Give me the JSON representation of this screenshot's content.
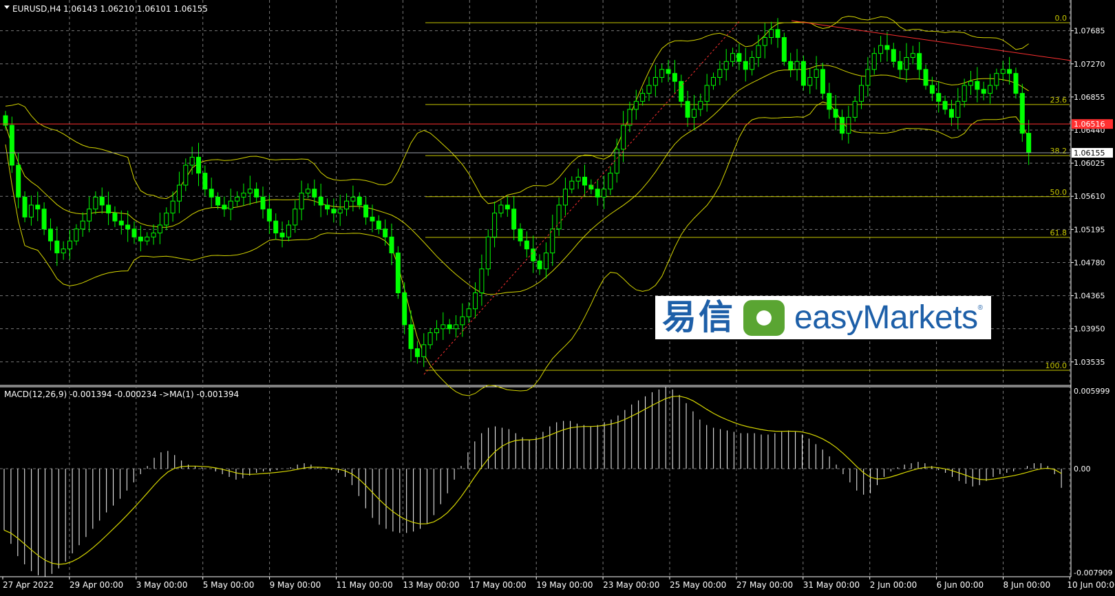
{
  "header": {
    "symbol": "EURUSD,H4",
    "ohlc": "1.06143 1.06210 1.06101 1.06155"
  },
  "macd_header": {
    "label": "MACD(12,26,9) -0.001394 -0.000234  ->MA(1) -0.001394"
  },
  "price_axis": {
    "ticks": [
      "1.07685",
      "1.07270",
      "1.06855",
      "1.06440",
      "1.06025",
      "1.05610",
      "1.05195",
      "1.04780",
      "1.04365",
      "1.03950",
      "1.03535"
    ],
    "red_level_label": "1.06516",
    "current_price_label": "1.06155"
  },
  "macd_axis": {
    "ticks": [
      "0.005999",
      "0.00",
      "-0.007909"
    ]
  },
  "time_axis": {
    "ticks": [
      "27 Apr 2022",
      "29 Apr 00:00",
      "3 May 00:00",
      "5 May 00:00",
      "9 May 00:00",
      "11 May 00:00",
      "13 May 00:00",
      "17 May 00:00",
      "19 May 00:00",
      "23 May 00:00",
      "25 May 00:00",
      "27 May 00:00",
      "31 May 00:00",
      "2 Jun 00:00",
      "6 Jun 00:00",
      "8 Jun 00:00",
      "10 Jun 00:00"
    ]
  },
  "fibonacci": {
    "levels": [
      {
        "label": "0.0",
        "price": 1.07785
      },
      {
        "label": "23.6",
        "price": 1.0676
      },
      {
        "label": "38.2",
        "price": 1.0612
      },
      {
        "label": "50.0",
        "price": 1.05605
      },
      {
        "label": "61.8",
        "price": 1.05095
      },
      {
        "label": "100.0",
        "price": 1.0343
      }
    ]
  },
  "logo": {
    "cn_text": "易信",
    "en_text": "easyMarkets",
    "reg_mark": "®"
  },
  "colors": {
    "background": "#000000",
    "grid": "#7a7a7a",
    "bull_candle": "#ffffff",
    "bear_candle": "#00ff00",
    "bollinger": "#d8d800",
    "fib": "#c8c800",
    "trendline": "#ff3030",
    "red_level": "#ff3030",
    "macd_hist": "#ffffff",
    "macd_signal": "#d8d800"
  },
  "chart_data": {
    "type": "candlestick",
    "symbol": "EURUSD",
    "timeframe": "H4",
    "ylim": [
      1.0324,
      1.0807
    ],
    "red_level": 1.06516,
    "current_price": 1.06155,
    "closes": [
      1.065,
      1.06,
      1.056,
      1.0535,
      1.055,
      1.0545,
      1.052,
      1.0505,
      1.049,
      1.0495,
      1.0505,
      1.052,
      1.053,
      1.0545,
      1.056,
      1.055,
      1.054,
      1.053,
      1.0525,
      1.052,
      1.051,
      1.0505,
      1.051,
      1.0515,
      1.0525,
      1.054,
      1.0555,
      1.0575,
      1.06,
      1.061,
      1.059,
      1.057,
      1.056,
      1.055,
      1.0545,
      1.0555,
      1.056,
      1.0565,
      1.057,
      1.056,
      1.0545,
      1.053,
      1.0515,
      1.051,
      1.0525,
      1.0545,
      1.0565,
      1.057,
      1.056,
      1.055,
      1.0545,
      1.054,
      1.0545,
      1.0555,
      1.056,
      1.055,
      1.0535,
      1.053,
      1.052,
      1.051,
      1.049,
      1.044,
      1.04,
      1.037,
      1.036,
      1.0375,
      1.039,
      1.0395,
      1.04,
      1.0395,
      1.04,
      1.041,
      1.042,
      1.044,
      1.047,
      1.051,
      1.054,
      1.055,
      1.0545,
      1.052,
      1.0505,
      1.0495,
      1.048,
      1.047,
      1.049,
      1.052,
      1.055,
      1.057,
      1.058,
      1.0585,
      1.0575,
      1.057,
      1.056,
      1.057,
      1.059,
      1.062,
      1.065,
      1.067,
      1.068,
      1.069,
      1.07,
      1.071,
      1.072,
      1.0715,
      1.0705,
      1.068,
      1.066,
      1.067,
      1.068,
      1.07,
      1.071,
      1.072,
      1.073,
      1.074,
      1.073,
      1.072,
      1.0735,
      1.075,
      1.076,
      1.077,
      1.076,
      1.073,
      1.072,
      1.073,
      1.07,
      1.071,
      1.072,
      1.069,
      1.067,
      1.066,
      1.064,
      1.066,
      1.068,
      1.07,
      1.072,
      1.074,
      1.075,
      1.0745,
      1.073,
      1.072,
      1.0735,
      1.074,
      1.072,
      1.07,
      1.069,
      1.068,
      1.067,
      1.066,
      1.068,
      1.07,
      1.0705,
      1.0695,
      1.069,
      1.07,
      1.0715,
      1.072,
      1.0715,
      1.069,
      1.064,
      1.06155
    ],
    "macd_histogram": [
      -0.0045,
      -0.0055,
      -0.0064,
      -0.007,
      -0.0075,
      -0.0078,
      -0.0079,
      -0.0077,
      -0.0073,
      -0.0068,
      -0.0062,
      -0.0056,
      -0.005,
      -0.0044,
      -0.0038,
      -0.0032,
      -0.0027,
      -0.0022,
      -0.0016,
      -0.001,
      -0.0004,
      0.0002,
      0.0008,
      0.0012,
      0.0013,
      0.001,
      0.0006,
      0.0003,
      0.0002,
      0.0001,
      0.0,
      -0.0002,
      -0.0004,
      -0.0006,
      -0.0008,
      -0.0007,
      -0.0005,
      -0.0003,
      -0.0002,
      -0.0002,
      -0.0001,
      0.0,
      0.0001,
      0.0003,
      0.0004,
      0.0003,
      0.0001,
      0.0,
      -0.0001,
      -0.0003,
      -0.0006,
      -0.0012,
      -0.002,
      -0.0029,
      -0.0036,
      -0.0041,
      -0.0044,
      -0.0046,
      -0.0047,
      -0.0047,
      -0.0046,
      -0.0044,
      -0.004,
      -0.0034,
      -0.0026,
      -0.0018,
      -0.0008,
      0.0002,
      0.0012,
      0.002,
      0.0026,
      0.003,
      0.0031,
      0.003,
      0.0029,
      0.0026,
      0.0023,
      0.0021,
      0.0023,
      0.0027,
      0.0031,
      0.0034,
      0.0035,
      0.0035,
      0.0033,
      0.0032,
      0.0031,
      0.0032,
      0.0034,
      0.0036,
      0.0039,
      0.0043,
      0.0047,
      0.005,
      0.0053,
      0.0056,
      0.0058,
      0.006,
      0.0058,
      0.0054,
      0.0048,
      0.0042,
      0.0036,
      0.0032,
      0.003,
      0.0029,
      0.0028,
      0.0027,
      0.0026,
      0.0026,
      0.0026,
      0.0025,
      0.0025,
      0.0026,
      0.0027,
      0.0028,
      0.0027,
      0.0025,
      0.0022,
      0.0018,
      0.0014,
      0.0009,
      0.0003,
      -0.0004,
      -0.001,
      -0.0016,
      -0.0019,
      -0.0018,
      -0.0012,
      -0.0006,
      -0.0002,
      0.0001,
      0.0003,
      0.0004,
      0.0005,
      0.0004,
      0.0002,
      -0.0001,
      -0.0003,
      -0.0006,
      -0.0009,
      -0.0011,
      -0.0013,
      -0.0012,
      -0.0009,
      -0.0006,
      -0.0004,
      -0.0003,
      -0.0002,
      0.0,
      0.0002,
      0.0004,
      0.0004,
      0.0002,
      -0.0004,
      -0.0014
    ]
  }
}
